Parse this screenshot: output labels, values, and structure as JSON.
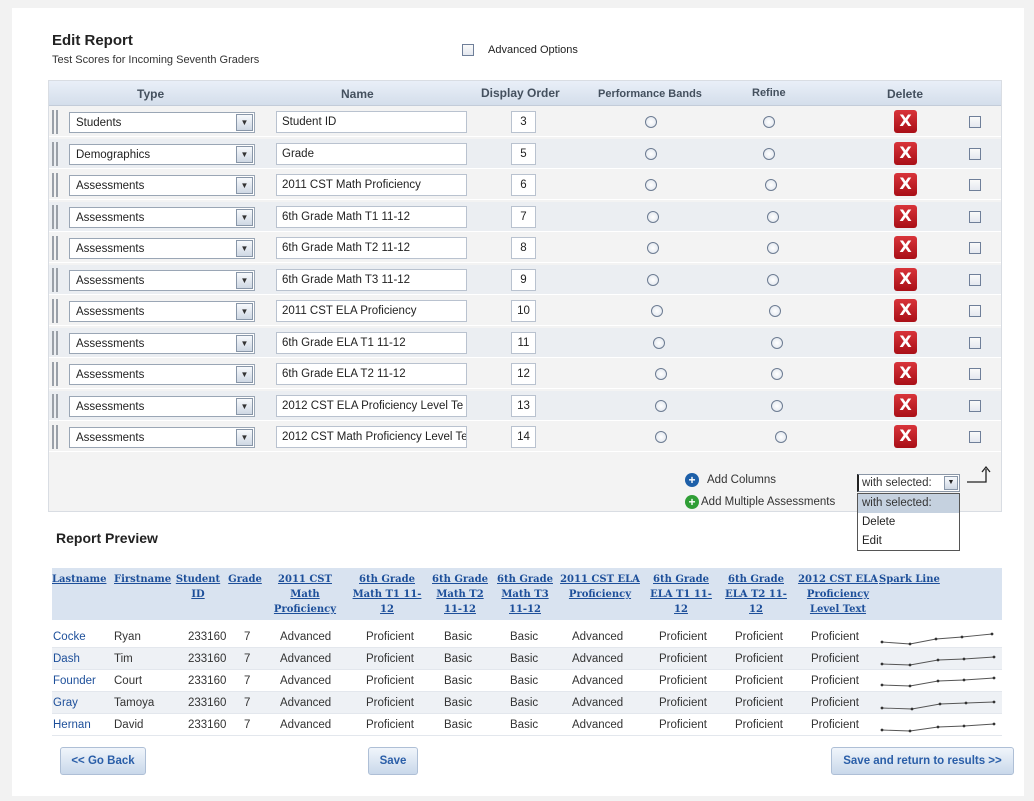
{
  "header": {
    "title": "Edit Report",
    "subtitle": "Test Scores for Incoming Seventh Graders",
    "advanced_options_label": "Advanced Options"
  },
  "editor": {
    "columns": {
      "type": "Type",
      "name": "Name",
      "display_order": "Display Order",
      "performance_bands": "Performance Bands",
      "refine": "Refine",
      "delete": "Delete"
    },
    "rows": [
      {
        "type": "Students",
        "name": "Student ID",
        "order": "3"
      },
      {
        "type": "Demographics",
        "name": "Grade",
        "order": "5"
      },
      {
        "type": "Assessments",
        "name": "2011 CST Math Proficiency",
        "order": "6"
      },
      {
        "type": "Assessments",
        "name": "6th Grade Math T1 11-12",
        "order": "7"
      },
      {
        "type": "Assessments",
        "name": "6th Grade Math T2 11-12",
        "order": "8"
      },
      {
        "type": "Assessments",
        "name": "6th Grade Math T3 11-12",
        "order": "9"
      },
      {
        "type": "Assessments",
        "name": "2011 CST ELA Proficiency",
        "order": "10"
      },
      {
        "type": "Assessments",
        "name": "6th Grade ELA T1 11-12",
        "order": "11"
      },
      {
        "type": "Assessments",
        "name": "6th Grade ELA T2 11-12",
        "order": "12"
      },
      {
        "type": "Assessments",
        "name": "2012 CST ELA Proficiency Level Te",
        "order": "13"
      },
      {
        "type": "Assessments",
        "name": "2012 CST Math Proficiency Level Te",
        "order": "14"
      }
    ],
    "delete_glyph": "X",
    "add_columns_label": "Add Columns",
    "add_multiple_label": "Add Multiple Assessments",
    "with_selected": {
      "value": "with selected:",
      "options": [
        "with selected:",
        "Delete",
        "Edit"
      ]
    }
  },
  "preview": {
    "title": "Report Preview",
    "headers": [
      "Lastname",
      "Firstname",
      "Student ID",
      "Grade",
      "2011 CST Math Proficiency",
      "6th Grade Math T1 11-12",
      "6th Grade Math T2 11-12",
      "6th Grade Math T3 11-12",
      "2011 CST ELA Proficiency",
      "6th Grade ELA T1 11-12",
      "6th Grade ELA T2 11-12",
      "2012 CST ELA Proficiency Level Text",
      "Spark Line"
    ],
    "rows": [
      [
        "Cocke",
        "Ryan",
        "233160",
        "7",
        "Advanced",
        "Proficient",
        "Basic",
        "Basic",
        "Advanced",
        "Proficient",
        "Proficient",
        "Proficient"
      ],
      [
        "Dash",
        "Tim",
        "233160",
        "7",
        "Advanced",
        "Proficient",
        "Basic",
        "Basic",
        "Advanced",
        "Proficient",
        "Proficient",
        "Proficient"
      ],
      [
        "Founder",
        "Court",
        "233160",
        "7",
        "Advanced",
        "Proficient",
        "Basic",
        "Basic",
        "Advanced",
        "Proficient",
        "Proficient",
        "Proficient"
      ],
      [
        "Gray",
        "Tamoya",
        "233160",
        "7",
        "Advanced",
        "Proficient",
        "Basic",
        "Basic",
        "Advanced",
        "Proficient",
        "Proficient",
        "Proficient"
      ],
      [
        "Hernan",
        "David",
        "233160",
        "7",
        "Advanced",
        "Proficient",
        "Basic",
        "Basic",
        "Advanced",
        "Proficient",
        "Proficient",
        "Proficient"
      ]
    ]
  },
  "buttons": {
    "go_back": "<< Go Back",
    "save": "Save",
    "save_return": "Save and return to results >>"
  },
  "colors": {
    "link_blue": "#1d4f9a",
    "delete_red": "#c0141c",
    "header_bg": "#d9e3f0"
  }
}
